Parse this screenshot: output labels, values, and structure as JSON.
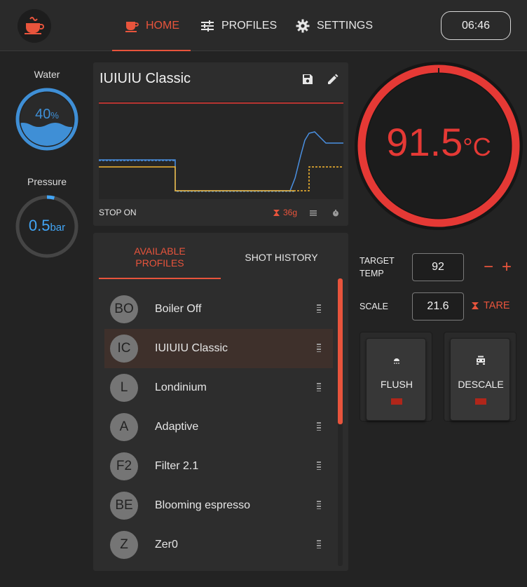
{
  "header": {
    "nav": [
      {
        "label": "HOME",
        "icon": "coffee-cup-icon",
        "active": true
      },
      {
        "label": "PROFILES",
        "icon": "sliders-icon",
        "active": false
      },
      {
        "label": "SETTINGS",
        "icon": "gear-icon",
        "active": false
      }
    ],
    "time": "06:46"
  },
  "water": {
    "label": "Water",
    "value": "40",
    "unit": "%",
    "level_percent": 40
  },
  "pressure": {
    "label": "Pressure",
    "value": "0.5",
    "unit": "bar",
    "fraction_of_max": 0.04
  },
  "profile": {
    "name": "IUIUIU Classic",
    "stop_on_label": "STOP ON",
    "weight": "36g"
  },
  "tabs": {
    "available": "AVAILABLE PROFILES",
    "history": "SHOT HISTORY"
  },
  "profiles": [
    {
      "initials": "BO",
      "name": "Boiler Off"
    },
    {
      "initials": "IC",
      "name": "IUIUIU Classic",
      "selected": true
    },
    {
      "initials": "L",
      "name": "Londinium"
    },
    {
      "initials": "A",
      "name": "Adaptive"
    },
    {
      "initials": "F2",
      "name": "Filter 2.1"
    },
    {
      "initials": "BE",
      "name": "Blooming espresso"
    },
    {
      "initials": "Z",
      "name": "Zer0"
    }
  ],
  "temperature": {
    "value": "91.5",
    "unit": "°C"
  },
  "target_temp": {
    "label": "TARGET TEMP",
    "value": "92",
    "minus": "−",
    "plus": "+"
  },
  "scale": {
    "label": "SCALE",
    "value": "21.6",
    "tare_label": "TARE"
  },
  "actions": {
    "flush": "FLUSH",
    "descale": "DESCALE"
  },
  "colors": {
    "accent": "#e8543c",
    "temp_red": "#e53935",
    "water_blue": "#3f8fd6",
    "pressure_blue": "#42a5f5",
    "chart_yellow": "#f5b731"
  }
}
